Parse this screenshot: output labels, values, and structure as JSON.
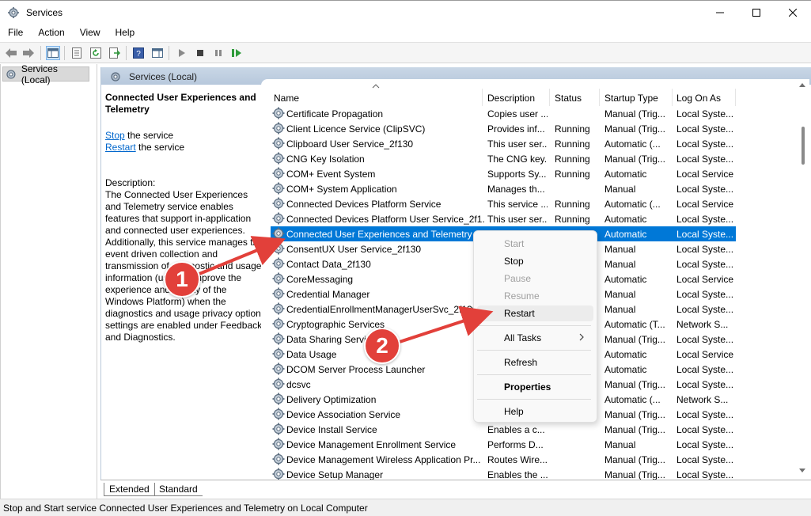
{
  "window": {
    "title": "Services"
  },
  "menu": [
    "File",
    "Action",
    "View",
    "Help"
  ],
  "tree": {
    "root_label": "Services (Local)"
  },
  "content": {
    "header_title": "Services (Local)"
  },
  "description": {
    "service_name": "Connected User Experiences and Telemetry",
    "stop_link": "Stop",
    "stop_suffix": " the service",
    "restart_link": "Restart",
    "restart_suffix": " the service",
    "label": "Description:",
    "text": "The Connected User Experiences and Telemetry service enables features that support in-application and connected user experiences. Additionally, this service manages the event driven collection and transmission of diagnostic and usage information (used to improve the experience and quality of the Windows Platform) when the diagnostics and usage privacy option settings are enabled under Feedback and Diagnostics."
  },
  "columns": [
    "Name",
    "Description",
    "Status",
    "Startup Type",
    "Log On As"
  ],
  "rows": [
    {
      "name": "Certificate Propagation",
      "desc": "Copies user ...",
      "status": "",
      "startup": "Manual (Trig...",
      "logon": "Local Syste..."
    },
    {
      "name": "Client Licence Service (ClipSVC)",
      "desc": "Provides inf...",
      "status": "Running",
      "startup": "Manual (Trig...",
      "logon": "Local Syste..."
    },
    {
      "name": "Clipboard User Service_2f130",
      "desc": "This user ser...",
      "status": "Running",
      "startup": "Automatic (...",
      "logon": "Local Syste..."
    },
    {
      "name": "CNG Key Isolation",
      "desc": "The CNG key...",
      "status": "Running",
      "startup": "Manual (Trig...",
      "logon": "Local Syste..."
    },
    {
      "name": "COM+ Event System",
      "desc": "Supports Sy...",
      "status": "Running",
      "startup": "Automatic",
      "logon": "Local Service"
    },
    {
      "name": "COM+ System Application",
      "desc": "Manages th...",
      "status": "",
      "startup": "Manual",
      "logon": "Local Syste..."
    },
    {
      "name": "Connected Devices Platform Service",
      "desc": "This service ...",
      "status": "Running",
      "startup": "Automatic (...",
      "logon": "Local Service"
    },
    {
      "name": "Connected Devices Platform User Service_2f1...",
      "desc": "This user ser...",
      "status": "Running",
      "startup": "Automatic",
      "logon": "Local Syste..."
    },
    {
      "name": "Connected User Experiences and Telemetry",
      "desc": "The C...",
      "status": "Runni...",
      "startup": "Automatic",
      "logon": "Local Syste...",
      "selected": true
    },
    {
      "name": "ConsentUX User Service_2f130",
      "desc": "",
      "status": "",
      "startup": "Manual",
      "logon": "Local Syste..."
    },
    {
      "name": "Contact Data_2f130",
      "desc": "",
      "status": "",
      "startup": "Manual",
      "logon": "Local Syste..."
    },
    {
      "name": "CoreMessaging",
      "desc": "",
      "status": "",
      "startup": "Automatic",
      "logon": "Local Service"
    },
    {
      "name": "Credential Manager",
      "desc": "",
      "status": "",
      "startup": "Manual",
      "logon": "Local Syste..."
    },
    {
      "name": "CredentialEnrollmentManagerUserSvc_2f130",
      "desc": "",
      "status": "",
      "startup": "Manual",
      "logon": "Local Syste..."
    },
    {
      "name": "Cryptographic Services",
      "desc": "",
      "status": "",
      "startup": "Automatic (T...",
      "logon": "Network S..."
    },
    {
      "name": "Data Sharing Service",
      "desc": "",
      "status": "",
      "startup": "Manual (Trig...",
      "logon": "Local Syste..."
    },
    {
      "name": "Data Usage",
      "desc": "",
      "status": "",
      "startup": "Automatic",
      "logon": "Local Service"
    },
    {
      "name": "DCOM Server Process Launcher",
      "desc": "",
      "status": "",
      "startup": "Automatic",
      "logon": "Local Syste..."
    },
    {
      "name": "dcsvc",
      "desc": "",
      "status": "",
      "startup": "Manual (Trig...",
      "logon": "Local Syste..."
    },
    {
      "name": "Delivery Optimization",
      "desc": "",
      "status": "",
      "startup": "Automatic (...",
      "logon": "Network S..."
    },
    {
      "name": "Device Association Service",
      "desc": "",
      "status": "",
      "startup": "Manual (Trig...",
      "logon": "Local Syste..."
    },
    {
      "name": "Device Install Service",
      "desc": "Enables a c...",
      "status": "",
      "startup": "Manual (Trig...",
      "logon": "Local Syste..."
    },
    {
      "name": "Device Management Enrollment Service",
      "desc": "Performs D...",
      "status": "",
      "startup": "Manual",
      "logon": "Local Syste..."
    },
    {
      "name": "Device Management Wireless Application Pr...",
      "desc": "Routes Wire...",
      "status": "",
      "startup": "Manual (Trig...",
      "logon": "Local Syste..."
    },
    {
      "name": "Device Setup Manager",
      "desc": "Enables the ...",
      "status": "",
      "startup": "Manual (Trig...",
      "logon": "Local Syste..."
    }
  ],
  "context_menu": {
    "start": "Start",
    "stop": "Stop",
    "pause": "Pause",
    "resume": "Resume",
    "restart": "Restart",
    "all_tasks": "All Tasks",
    "refresh": "Refresh",
    "properties": "Properties",
    "help": "Help"
  },
  "tabs": [
    "Extended",
    "Standard"
  ],
  "status_bar": "Stop and Start service Connected User Experiences and Telemetry on Local Computer",
  "annotations": {
    "badge1": "1",
    "badge2": "2",
    "color": "#e2403a"
  },
  "colors": {
    "selection": "#0078d7",
    "header": "#c9d7e6",
    "link": "#0066cc"
  }
}
